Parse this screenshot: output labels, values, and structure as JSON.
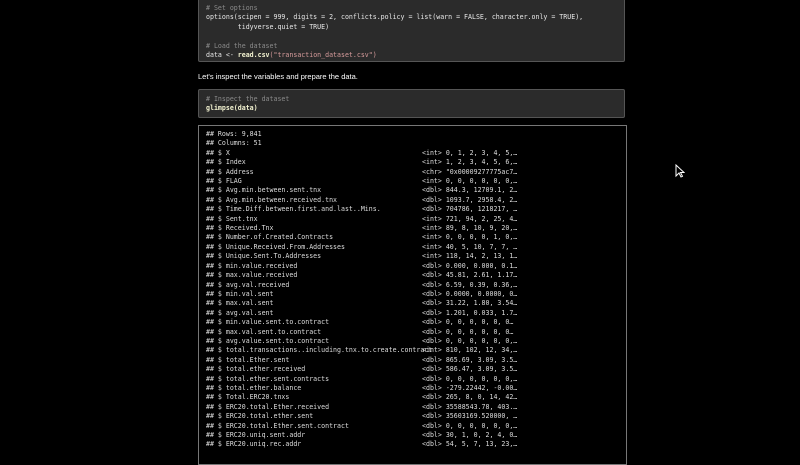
{
  "code_block_1": {
    "comment1": "# Set options",
    "line1a": "options(scipen = 999, digits = 2, conflicts.policy = list(warn = FALSE, character.only = TRUE),",
    "line1b": "        tidyverse.quiet = TRUE)",
    "comment2": "# Load the dataset",
    "line2_prefix": "data <- ",
    "line2_fn": "read.csv",
    "line2_arg": "(\"transaction_dataset.csv\")"
  },
  "prose": "Let's inspect the variables and prepare the data.",
  "code_block_2": {
    "comment": "# Inspect the dataset",
    "code": "glimpse(data)"
  },
  "output": {
    "header": [
      "## Rows: 9,841",
      "## Columns: 51"
    ],
    "rows": [
      {
        "name": "## $ X",
        "type": "<int> 0, 1, 2, 3, 4, 5,…"
      },
      {
        "name": "## $ Index",
        "type": "<int> 1, 2, 3, 4, 5, 6,…"
      },
      {
        "name": "## $ Address",
        "type": "<chr> \"0x00009277775ac7…"
      },
      {
        "name": "## $ FLAG",
        "type": "<int> 0, 0, 0, 0, 0, 0,…"
      },
      {
        "name": "## $ Avg.min.between.sent.tnx",
        "type": "<dbl> 844.3, 12709.1, 2…"
      },
      {
        "name": "## $ Avg.min.between.received.tnx",
        "type": "<dbl> 1093.7, 2958.4, 2…"
      },
      {
        "name": "## $ Time.Diff.between.first.and.last..Mins.",
        "type": "<dbl> 704786, 1218217, …"
      },
      {
        "name": "## $ Sent.tnx",
        "type": "<int> 721, 94, 2, 25, 4…"
      },
      {
        "name": "## $ Received.Tnx",
        "type": "<int> 89, 8, 10, 9, 20,…"
      },
      {
        "name": "## $ Number.of.Created.Contracts",
        "type": "<int> 0, 0, 0, 0, 1, 0,…"
      },
      {
        "name": "## $ Unique.Received.From.Addresses",
        "type": "<int> 40, 5, 10, 7, 7, …"
      },
      {
        "name": "## $ Unique.Sent.To.Addresses",
        "type": "<int> 118, 14, 2, 13, 1…"
      },
      {
        "name": "## $ min.value.received",
        "type": "<dbl> 0.000, 0.000, 0.1…"
      },
      {
        "name": "## $ max.value.received",
        "type": "<dbl> 45.81, 2.61, 1.17…"
      },
      {
        "name": "## $ avg.val.received",
        "type": "<dbl> 6.59, 0.39, 0.36,…"
      },
      {
        "name": "## $ min.val.sent",
        "type": "<dbl> 0.0000, 0.0000, 0…"
      },
      {
        "name": "## $ max.val.sent",
        "type": "<dbl> 31.22, 1.80, 3.54…"
      },
      {
        "name": "## $ avg.val.sent",
        "type": "<dbl> 1.201, 0.033, 1.7…"
      },
      {
        "name": "## $ min.value.sent.to.contract",
        "type": "<dbl> 0, 0, 0, 0, 0, 0…"
      },
      {
        "name": "## $ max.val.sent.to.contract",
        "type": "<dbl> 0, 0, 0, 0, 0, 0…"
      },
      {
        "name": "## $ avg.value.sent.to.contract",
        "type": "<dbl> 0, 0, 0, 0, 0, 0,…"
      },
      {
        "name": "## $ total.transactions..including.tnx.to.create.contract",
        "type": "<int> 810, 102, 12, 34,…"
      },
      {
        "name": "## $ total.Ether.sent",
        "type": "<dbl> 865.69, 3.09, 3.5…"
      },
      {
        "name": "## $ total.ether.received",
        "type": "<dbl> 586.47, 3.09, 3.5…"
      },
      {
        "name": "## $ total.ether.sent.contracts",
        "type": "<dbl> 0, 0, 0, 0, 0, 0,…"
      },
      {
        "name": "## $ total.ether.balance",
        "type": "<dbl> -279.22442, -0.00…"
      },
      {
        "name": "## $ Total.ERC20.tnxs",
        "type": "<dbl> 265, 8, 0, 14, 42…"
      },
      {
        "name": "## $ ERC20.total.Ether.received",
        "type": "<dbl> 35588543.78, 403.…"
      },
      {
        "name": "## $ ERC20.total.ether.sent",
        "type": "<dbl> 35603169.520000, …"
      },
      {
        "name": "## $ ERC20.total.Ether.sent.contract",
        "type": "<dbl> 0, 0, 0, 0, 0, 0,…"
      },
      {
        "name": "## $ ERC20.uniq.sent.addr",
        "type": "<dbl> 30, 1, 0, 2, 4, 0…"
      },
      {
        "name": "## $ ERC20.uniq.rec.addr",
        "type": "<dbl> 54, 5, 7, 13, 23,…"
      }
    ]
  }
}
